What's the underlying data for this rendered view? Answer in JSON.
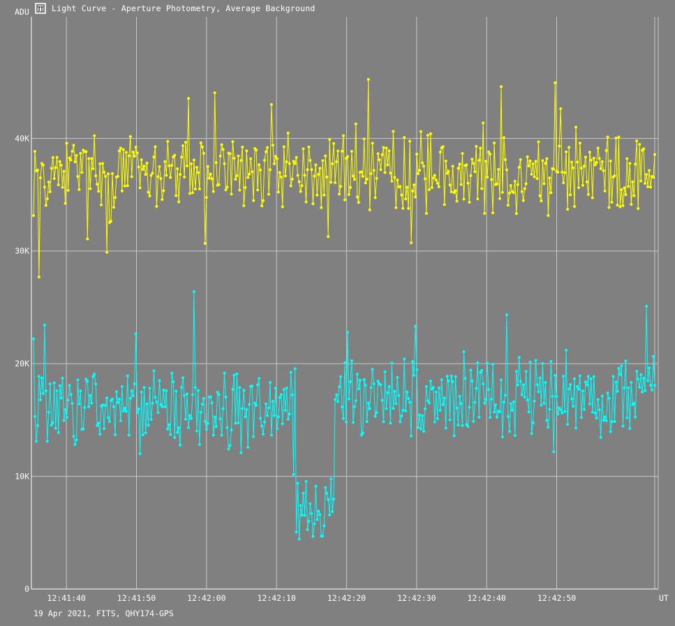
{
  "window": {
    "title": "Light Curve - Aperture Photometry, Average Background",
    "icon": "light-curve-app-icon"
  },
  "footer": {
    "info": "19 Apr 2021, FITS, QHY174-GPS"
  },
  "colors": {
    "background": "#808080",
    "grid": "#c8c8c8",
    "axis": "#ffffff",
    "text": "#ffffff",
    "series_target": "#ffff00",
    "series_comparison": "#00ffff"
  },
  "chart_data": {
    "type": "line",
    "title": "Light Curve - Aperture Photometry, Average Background",
    "ylabel": "ADU",
    "xlabel": "UT",
    "ylim": [
      0,
      50800
    ],
    "xlim_seconds_past_12_41_35": [
      0,
      89.5
    ],
    "x_tick_labels": [
      "12:41:40",
      "12:41:50",
      "12:42:00",
      "12:42:10",
      "12:42:20",
      "12:42:30",
      "12:42:40",
      "12:42:50"
    ],
    "y_tick_labels": [
      "0",
      "10K",
      "20K",
      "30K",
      "40K"
    ],
    "y_ticks": [
      0,
      10000,
      20000,
      30000,
      40000
    ],
    "grid": true,
    "markers": true,
    "series": [
      {
        "color": "#ffff00",
        "approx_points": 450,
        "mean": 37000,
        "noise_range": [
          27700,
          44600
        ],
        "notable_min": {
          "x": "12:41:36",
          "y": 27700
        },
        "notable_max": {
          "x": "12:42:42",
          "y": 44600
        }
      },
      {
        "color": "#00ffff",
        "approx_points": 450,
        "mean_before_dip": 16000,
        "mean_after_dip": 17000,
        "noise_range": [
          3400,
          26400
        ],
        "dip": {
          "start": "12:42:13",
          "end": "12:42:18",
          "depth_y": 7000
        },
        "notable_max": {
          "x": "12:41:58",
          "y": 26400
        }
      }
    ]
  }
}
